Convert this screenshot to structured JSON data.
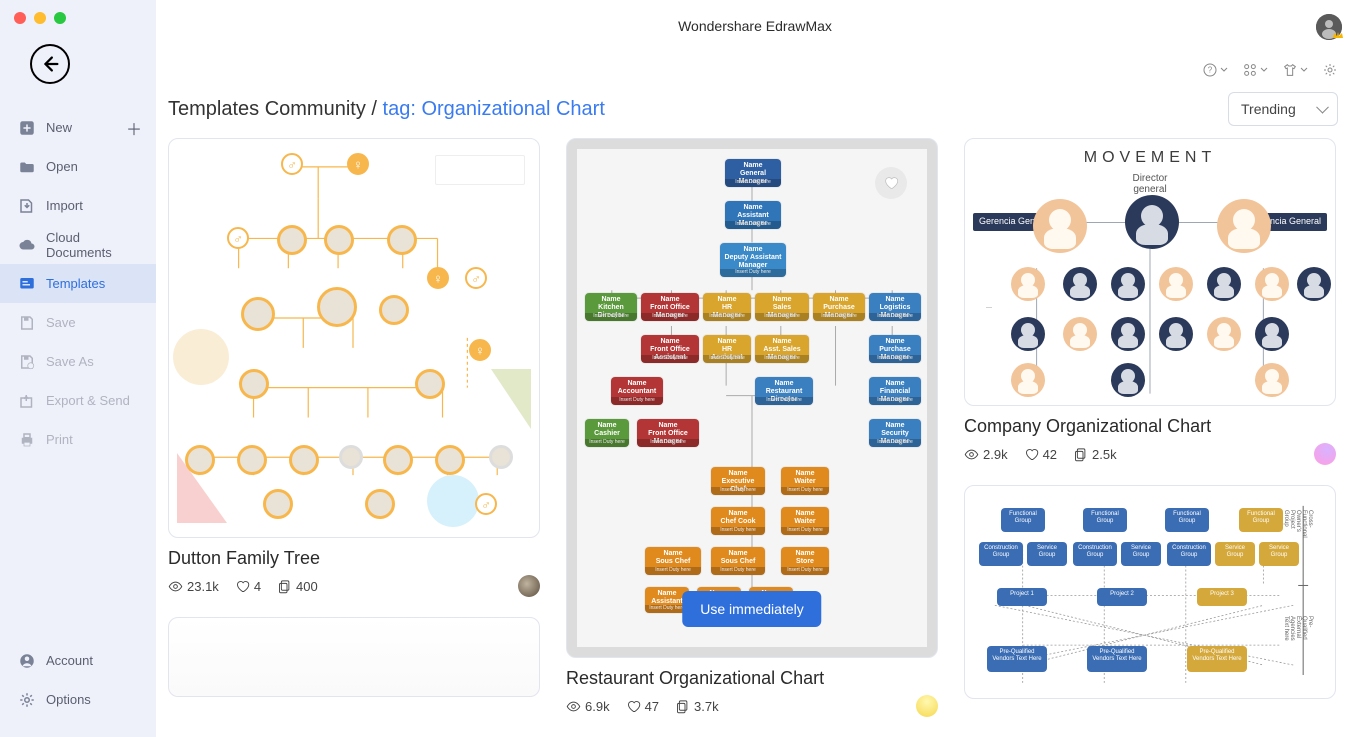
{
  "app_title": "Wondershare EdrawMax",
  "sidebar": {
    "items": [
      {
        "label": "New",
        "has_plus": true
      },
      {
        "label": "Open"
      },
      {
        "label": "Import"
      },
      {
        "label": "Cloud Documents"
      },
      {
        "label": "Templates",
        "active": true
      },
      {
        "label": "Save",
        "disabled": true
      },
      {
        "label": "Save As",
        "disabled": true
      },
      {
        "label": "Export & Send",
        "disabled": true
      },
      {
        "label": "Print",
        "disabled": true
      }
    ],
    "bottom": [
      {
        "label": "Account"
      },
      {
        "label": "Options"
      }
    ]
  },
  "crumbs": {
    "root": "Templates Community",
    "sep": "/",
    "tag": "tag: Organizational Chart"
  },
  "sort_label": "Trending",
  "cards": [
    {
      "title": "Dutton Family Tree",
      "views": "23.1k",
      "likes": "4",
      "copies": "400"
    },
    {
      "title": "Restaurant Organizational Chart",
      "views": "6.9k",
      "likes": "47",
      "copies": "3.7k",
      "use_btn": "Use immediately"
    },
    {
      "title": "Company Organizational Chart",
      "views": "2.9k",
      "likes": "42",
      "copies": "2.5k",
      "heading": "MOVEMENT",
      "subheading": "Director\ngeneral",
      "gerencia": "Gerencia\nGeneral"
    }
  ],
  "org_labels": {
    "gm": "Name\nGeneral Manager",
    "am": "Name\nAssistant Manager",
    "dam": "Name\nDeputy Assistant\nManager",
    "foot": "Insert Duty here",
    "kd": "Name\nKitchen Director",
    "fom": "Name\nFront Office Manager",
    "hrm": "Name\nHR Manager",
    "sm": "Name\nSales Manager",
    "asm": "Name\nAsst. Sales Manager",
    "pm": "Name\nPurchase Manager",
    "lm": "Name\nLogistics Manager",
    "hra": "Name\nHR Assistant",
    "foa": "Name\nFront Office Assistant",
    "rd": "Name\nRestaurant Director",
    "fm": "Name\nFinancial Manager",
    "sec": "Name\nSecurity Manager",
    "acc": "Name\nAccountant",
    "cash": "Name\nCashier",
    "exc": "Name\nExecutive Chef",
    "waiter": "Name\nWaiter",
    "chef": "Name\nChef Cook",
    "souschef": "Name\nSous Chef",
    "store": "Name\nStore",
    "ass": "Name\nAssistant"
  },
  "mlabels": {
    "fg": "Functional\nGroup",
    "cg": "Construction\nGroup",
    "sg": "Service\nGroup",
    "pj": "Project 1",
    "pj2": "Project 2",
    "pj3": "Project 3",
    "pq": "Pre-Qualified Vendors\nText Here",
    "side1": "Cross-Functional\nOwner's Project\nGroup",
    "side2": "Pre-Qualified\nExternal Agencies\nText here"
  }
}
